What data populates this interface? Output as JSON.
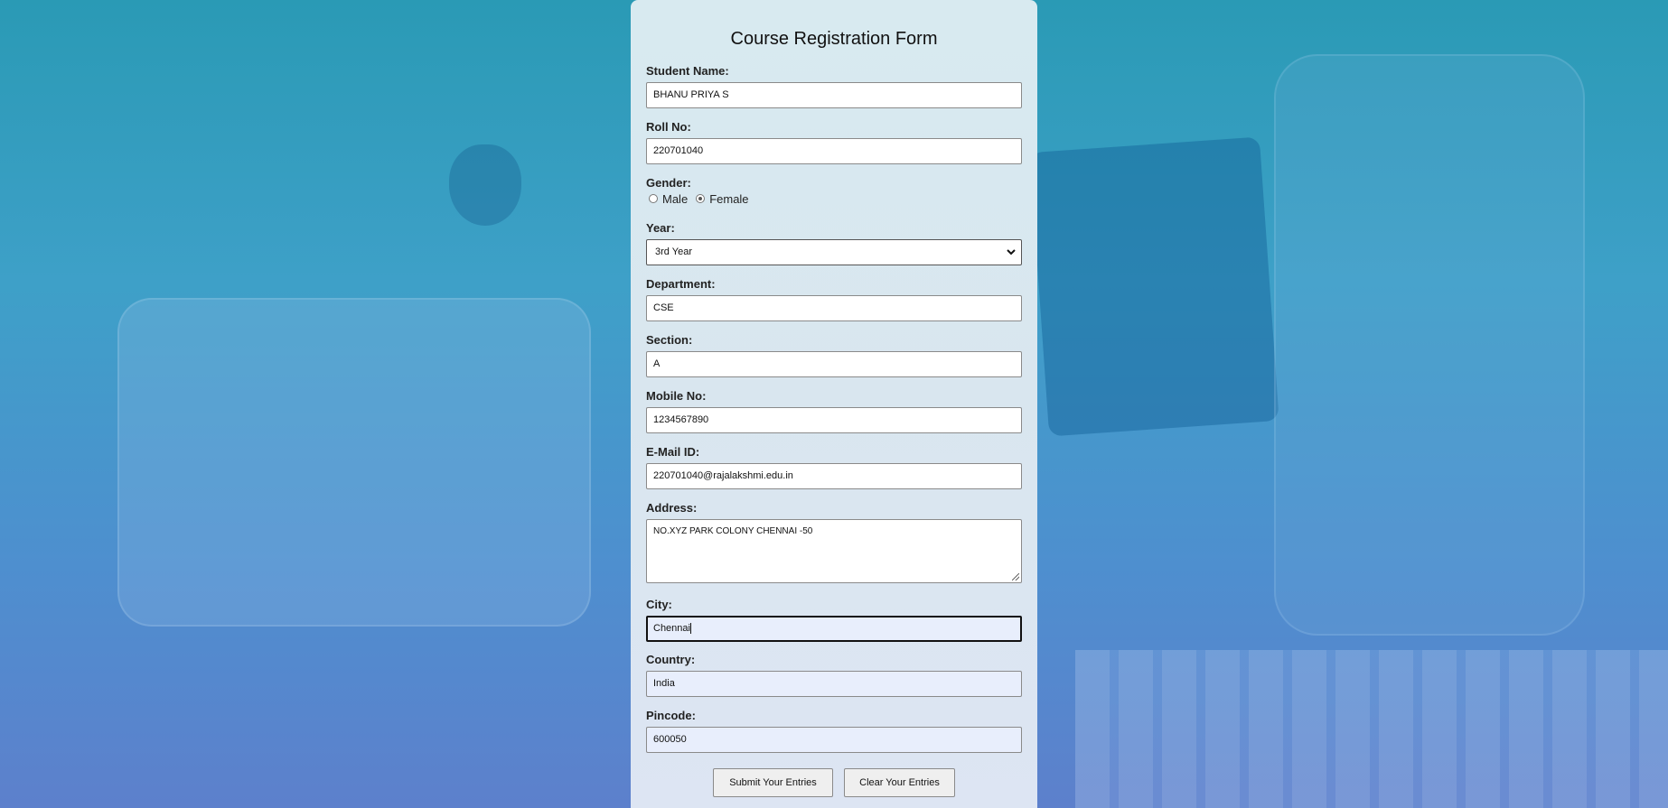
{
  "form": {
    "title": "Course Registration Form",
    "student_name": {
      "label": "Student Name:",
      "value": "BHANU PRIYA S"
    },
    "roll_no": {
      "label": "Roll No:",
      "value": "220701040"
    },
    "gender": {
      "label": "Gender:",
      "options": [
        "Male",
        "Female"
      ],
      "selected": "Female"
    },
    "year": {
      "label": "Year:",
      "value": "3rd Year"
    },
    "department": {
      "label": "Department:",
      "value": "CSE"
    },
    "section": {
      "label": "Section:",
      "value": "A"
    },
    "mobile": {
      "label": "Mobile No:",
      "value": "1234567890"
    },
    "email": {
      "label": "E-Mail ID:",
      "value": "220701040@rajalakshmi.edu.in"
    },
    "address": {
      "label": "Address:",
      "value": "NO.XYZ PARK COLONY CHENNAI -50"
    },
    "city": {
      "label": "City:",
      "value": "Chennai"
    },
    "country": {
      "label": "Country:",
      "value": "India"
    },
    "pincode": {
      "label": "Pincode:",
      "value": "600050"
    },
    "submit_label": "Submit Your Entries",
    "clear_label": "Clear Your Entries"
  },
  "icons": {
    "select_arrow": "chevron-down-icon",
    "resize": "resize-grip-icon"
  }
}
